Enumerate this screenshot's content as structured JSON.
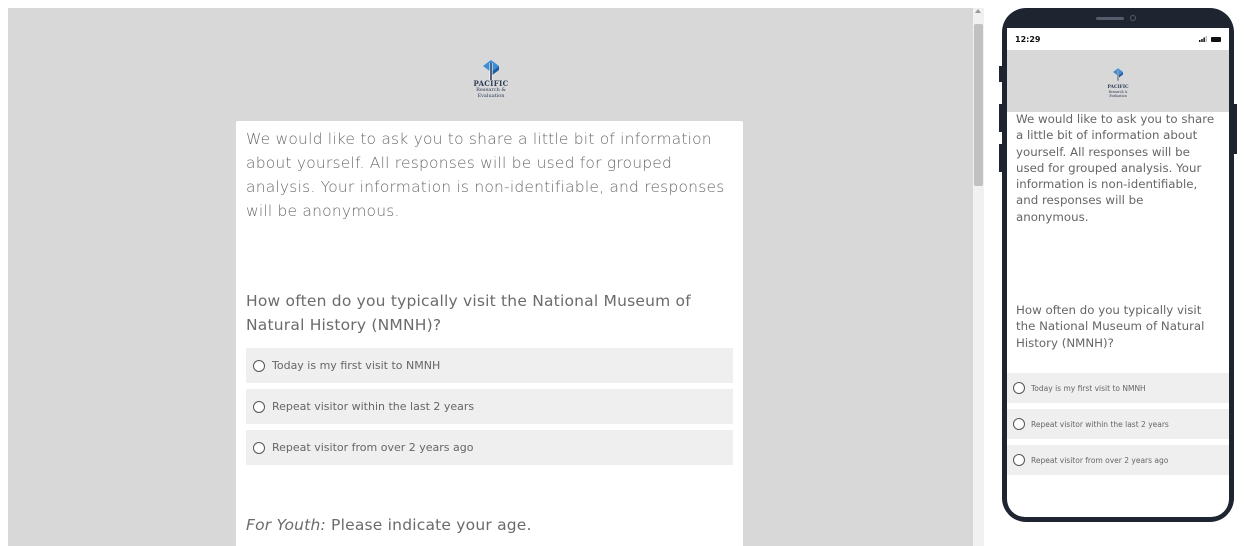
{
  "logo": {
    "line1": "PACIFIC",
    "line2": "Research &",
    "line3": "Evaluation"
  },
  "survey": {
    "intro": "We would like to ask you to share a little bit of information about yourself. All responses will be used for grouped analysis. Your information is non-identifiable, and responses will be anonymous.",
    "question": "How often do you typically visit the National Museum of Natural History (NMNH)?",
    "options": [
      "Today is my first visit to NMNH",
      "Repeat visitor within the last 2 years",
      "Repeat visitor from over 2 years ago"
    ],
    "youth_prefix": "For Youth:",
    "youth_text": " Please indicate your age."
  },
  "phone": {
    "time": "12:29"
  },
  "colors": {
    "background": "#d8d8d8",
    "option_bg": "#efefef",
    "text": "#6b6b6b",
    "phone_frame": "#1e2430"
  }
}
